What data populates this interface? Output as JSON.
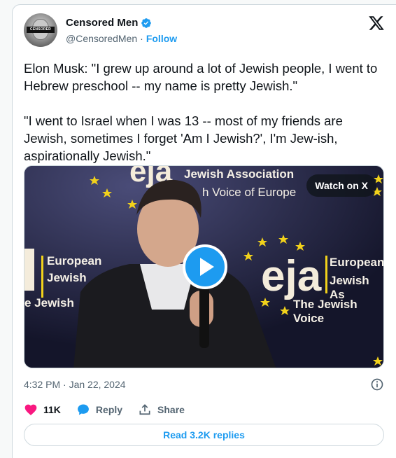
{
  "author": {
    "display_name": "Censored Men",
    "handle": "@CensoredMen",
    "separator": "·",
    "follow_label": "Follow",
    "avatar_label": "CENSORED"
  },
  "tweet": {
    "text": "Elon Musk: \"I grew up around a lot of Jewish people, I went to Hebrew preschool -- my name is pretty Jewish.\"\n\n\"I went to Israel when I was 13 -- most of my friends are Jewish, sometimes I forget 'Am I Jewish?', I'm Jew-ish, aspirationally Jewish.\""
  },
  "media": {
    "watch_label": "Watch on X",
    "banner": {
      "top_right": "Jewish Association",
      "top_right_sub": "h Voice of Europe",
      "left_line1": "European",
      "left_line2": "Jewish",
      "left_line3": "e Jewish",
      "right_logo": "eja",
      "right_line1": "European",
      "right_line2": "Jewish As",
      "right_line3": "The Jewish Voice",
      "top_logo": "eja"
    }
  },
  "meta": {
    "timestamp": "4:32 PM · Jan 22, 2024"
  },
  "actions": {
    "likes": "11K",
    "reply_label": "Reply",
    "share_label": "Share"
  },
  "replies_button": "Read 3.2K replies",
  "colors": {
    "accent": "#1d9bf0",
    "like": "#f91880",
    "text": "#0f1419",
    "muted": "#536471",
    "border": "#cfd9de"
  },
  "icons": [
    "verified-badge-icon",
    "x-logo-icon",
    "play-icon",
    "info-icon",
    "heart-icon",
    "reply-bubble-icon",
    "share-icon"
  ]
}
